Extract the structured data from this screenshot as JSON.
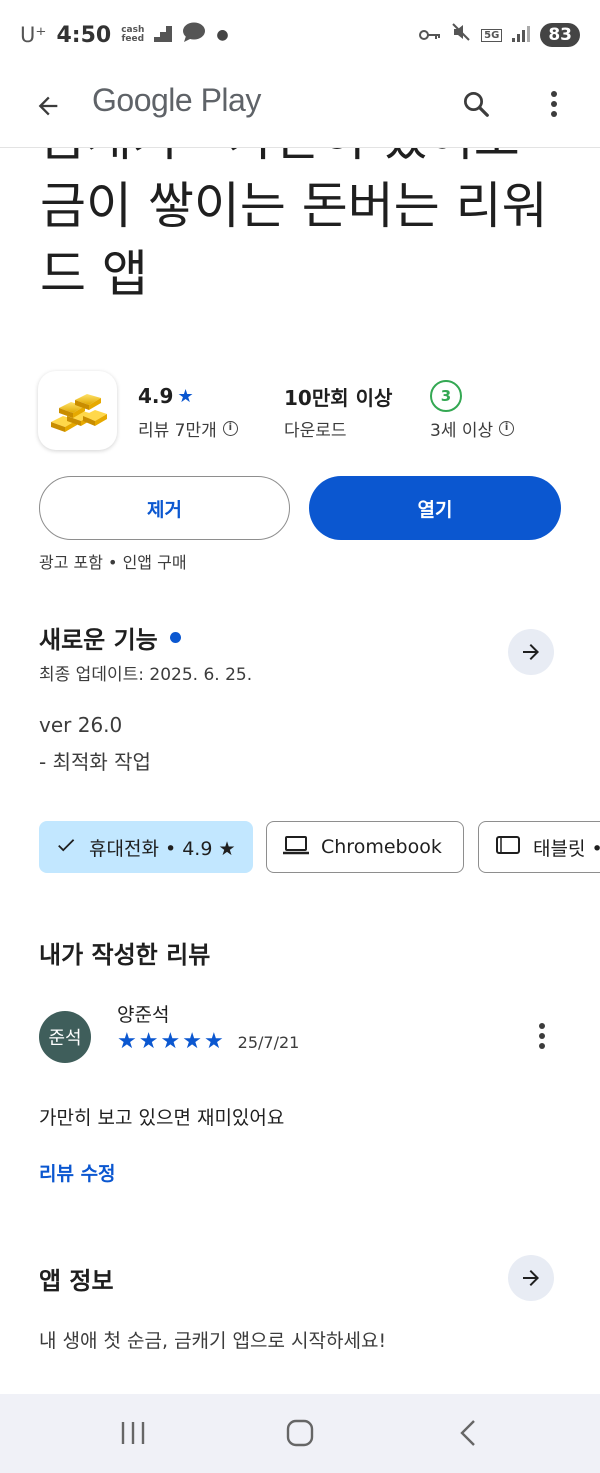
{
  "status_bar": {
    "carrier": "U⁺",
    "time": "4:50",
    "notification_top": "cash",
    "notification_bottom": "feed",
    "network": "5G",
    "battery": "83"
  },
  "app_bar": {
    "brand": "Google Play",
    "icons": [
      "back-arrow-icon",
      "search-icon",
      "more-vert-icon"
    ]
  },
  "app": {
    "title": "금캐기 - 가만히 있어도 금이 쌓이는 돈버는 리워드 앱",
    "icon": "gold-bars-icon",
    "rating": "4.9",
    "rating_star": "★",
    "reviews_label": "리뷰 7만개",
    "downloads": "10만회 이상",
    "downloads_label": "다운로드",
    "age_badge": "3",
    "age_label": "3세 이상",
    "remove_button": "제거",
    "open_button": "열기",
    "ads_note": "광고 포함 • 인앱 구매",
    "colors": {
      "accent": "#0b57d0",
      "age_green": "#34a853",
      "chip_selected": "#c2e7ff"
    }
  },
  "whats_new": {
    "title": "새로운 기능",
    "updated": "최종 업데이트: 2025. 6. 25.",
    "version": "ver 26.0",
    "note": "- 최적화 작업"
  },
  "devices": [
    {
      "label": "휴대전화 • 4.9 ★",
      "icon": "check-icon",
      "selected": true
    },
    {
      "label": "Chromebook",
      "icon": "laptop-icon",
      "selected": false
    },
    {
      "label": "태블릿 •",
      "icon": "tablet-icon",
      "selected": false
    }
  ],
  "my_review": {
    "section_title": "내가 작성한 리뷰",
    "avatar_text": "준석",
    "reviewer": "양준석",
    "stars": 5,
    "date": "25/7/21",
    "text": "가만히 보고 있으면 재미있어요",
    "edit_link": "리뷰 수정"
  },
  "app_info": {
    "title": "앱 정보",
    "text": "내 생애 첫 순금, 금캐기 앱으로 시작하세요!"
  },
  "nav_bar": {
    "icons": [
      "recents-icon",
      "home-icon",
      "back-icon"
    ]
  }
}
